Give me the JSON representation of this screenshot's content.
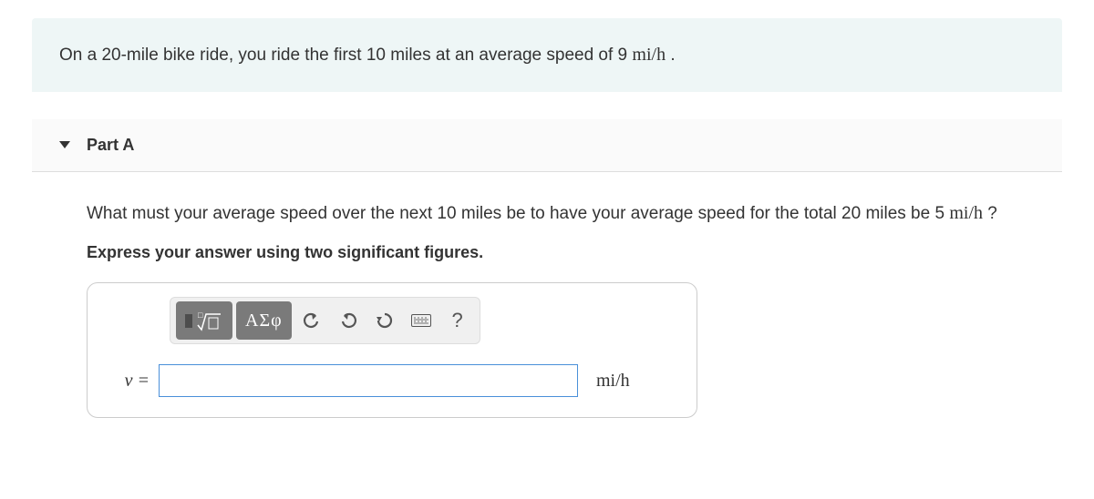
{
  "problem": {
    "intro_prefix": "On a 20-mile bike ride, you ride the first 10 miles at an average speed of 9 ",
    "intro_unit": "mi/h",
    "intro_suffix": " ."
  },
  "part": {
    "label": "Part A",
    "question_prefix": "What must your average speed over the next 10 miles be to have your average speed for the total 20 miles be 5 ",
    "question_unit": "mi/h",
    "question_suffix": " ?",
    "instructions": "Express your answer using two significant figures."
  },
  "toolbar": {
    "templates": "templates",
    "greek_label": "ΑΣφ",
    "undo": "↶",
    "redo": "↷",
    "reset": "↻",
    "keyboard": "keyboard",
    "help": "?"
  },
  "answer": {
    "variable": "v =",
    "value": "",
    "unit": "mi/h"
  }
}
